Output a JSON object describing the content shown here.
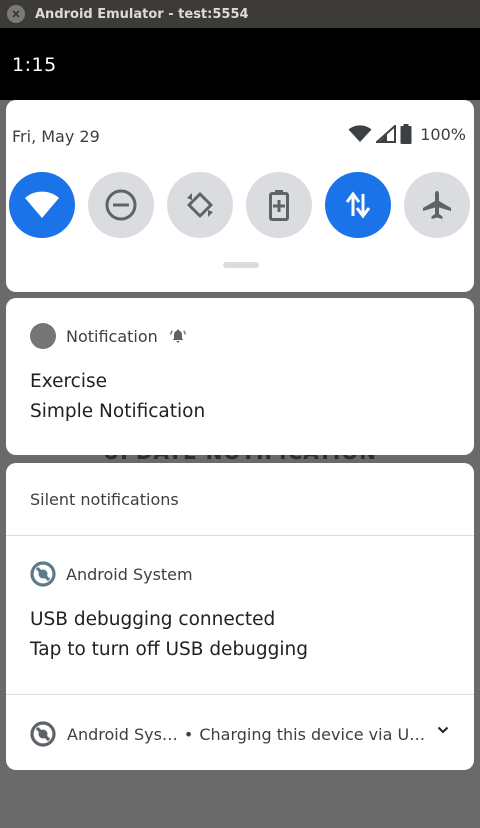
{
  "window": {
    "title": "Android Emulator - test:5554"
  },
  "status_bar": {
    "time": "1:15"
  },
  "backdrop": {
    "partial_text": "UPDATE NOTIFICATION"
  },
  "quick_settings": {
    "date": "Fri, May 29",
    "battery": "100%",
    "tiles": [
      {
        "icon": "wifi-icon",
        "active": true
      },
      {
        "icon": "do-not-disturb-icon",
        "active": false
      },
      {
        "icon": "auto-rotate-icon",
        "active": false
      },
      {
        "icon": "battery-saver-icon",
        "active": false
      },
      {
        "icon": "mobile-data-icon",
        "active": true
      },
      {
        "icon": "airplane-mode-icon",
        "active": false
      }
    ],
    "accent_color": "#1a73e8"
  },
  "notification_1": {
    "app_name": "Notification",
    "title": "Exercise",
    "text": "Simple Notification"
  },
  "silent_section": {
    "header": "Silent notifications",
    "usb_debugging": {
      "app_name": "Android System",
      "title": "USB debugging connected",
      "text": "Tap to turn off USB debugging"
    },
    "charging": {
      "app_name": "Android Sys…",
      "separator": "•",
      "text": "Charging this device via U…"
    }
  }
}
